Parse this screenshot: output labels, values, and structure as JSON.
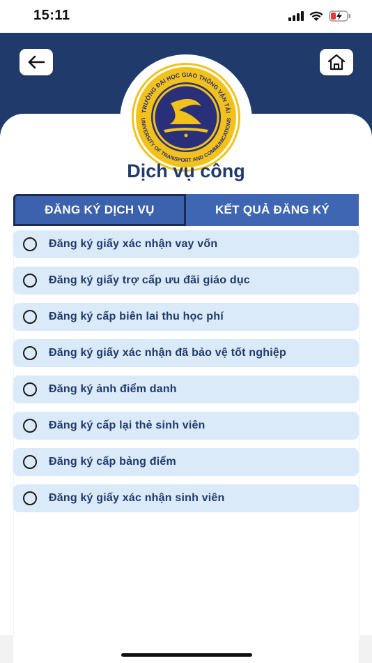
{
  "status": {
    "time": "15:11"
  },
  "header": {
    "back_icon": "arrow-left-icon",
    "home_icon": "home-icon",
    "logo": {
      "top_text": "TRƯỜNG ĐẠI HỌC GIAO THÔNG VẬN TẢI",
      "bottom_text": "UNIVERSITY OF TRANSPORT AND COMMUNICATIONS"
    }
  },
  "page": {
    "title": "Dịch vụ công"
  },
  "tabs": [
    {
      "label": "ĐĂNG KÝ DỊCH VỤ",
      "active": true
    },
    {
      "label": "KẾT QUẢ ĐĂNG KÝ",
      "active": false
    }
  ],
  "services": [
    {
      "label": "Đăng ký giấy xác nhận vay vốn"
    },
    {
      "label": "Đăng ký giấy trợ cấp ưu đãi giáo dục"
    },
    {
      "label": "Đăng ký cấp biên lai thu học phí"
    },
    {
      "label": "Đăng ký giấy xác nhận đã bảo vệ tốt nghiệp"
    },
    {
      "label": "Đăng ký ảnh điểm danh"
    },
    {
      "label": "Đăng ký cấp lại thẻ sinh viên"
    },
    {
      "label": "Đăng ký cấp bảng điểm"
    },
    {
      "label": "Đăng ký giấy xác nhận sinh viên"
    }
  ],
  "colors": {
    "header": "#1f3a6b",
    "tab": "#3c62ae",
    "item_bg": "#dbeaf8",
    "text": "#1f3a6b",
    "logo_gold": "#f2c21b",
    "logo_navy": "#2a2f7a"
  }
}
